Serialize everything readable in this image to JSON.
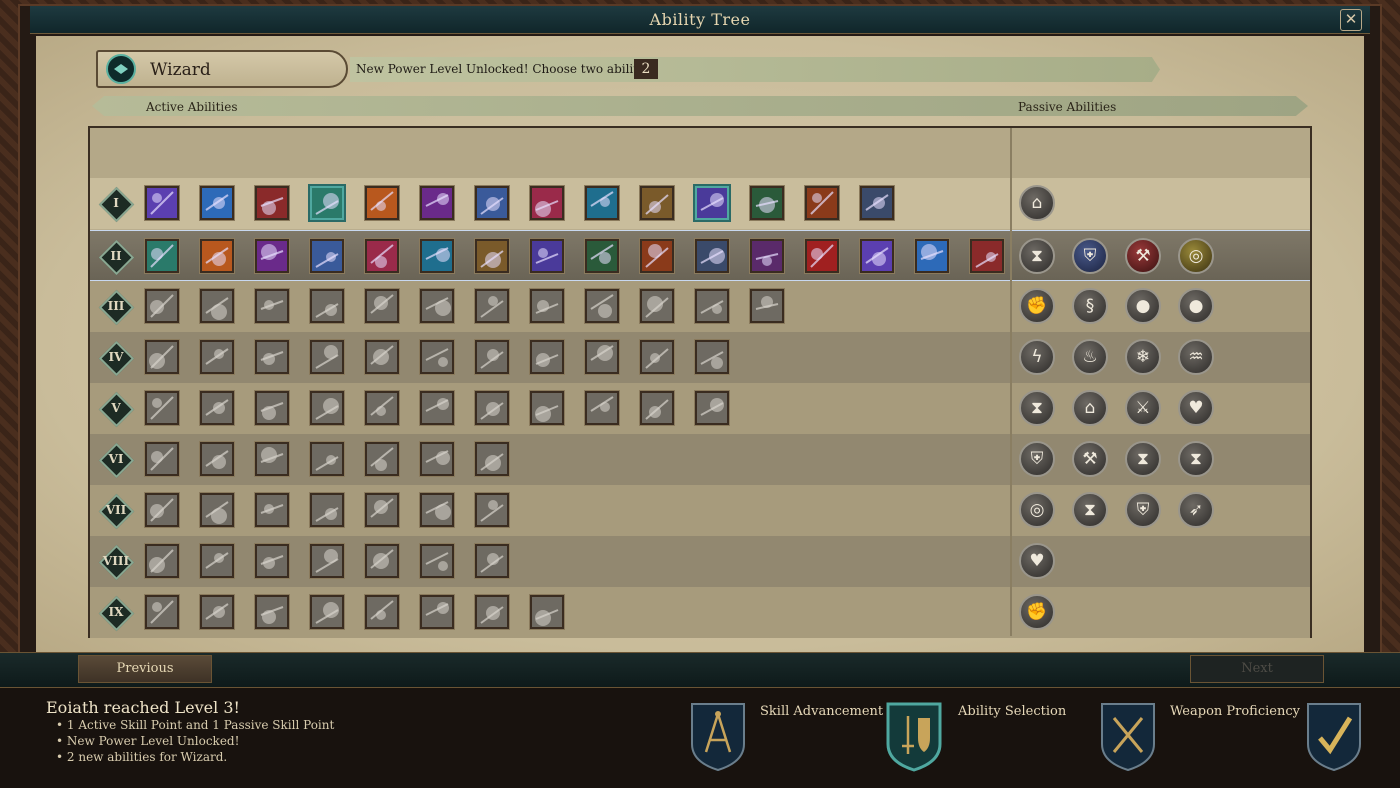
{
  "window": {
    "title": "Ability Tree"
  },
  "class_panel": {
    "name": "Wizard"
  },
  "banner": {
    "text": "New Power Level Unlocked! Choose two abilities.",
    "count": "2"
  },
  "sections": {
    "active": "Active Abilities",
    "passive": "Passive Abilities"
  },
  "levels": [
    "I",
    "II",
    "III",
    "IV",
    "V",
    "VI",
    "VII",
    "VIII",
    "IX"
  ],
  "selected_level": "II",
  "active_icon_counts": [
    14,
    16,
    12,
    11,
    11,
    7,
    7,
    7,
    8
  ],
  "passive_icons": [
    [
      "compass-icon"
    ],
    [
      "hourglass-icon",
      "shield-icon",
      "axe-icon",
      "target-icon"
    ],
    [
      "strength-icon",
      "serpent-icon",
      "mind-icon",
      "mind-icon"
    ],
    [
      "lightning-icon",
      "fire-icon",
      "frost-icon",
      "water-drop-icon"
    ],
    [
      "hourglass-icon",
      "compass-icon",
      "sword-icon",
      "heart-icon"
    ],
    [
      "shield-icon",
      "hammer-icon",
      "hourglass-icon",
      "hourglass-icon"
    ],
    [
      "target-icon",
      "hourglass-icon",
      "shield-icon",
      "bow-icon"
    ],
    [
      "heart-icon"
    ],
    [
      "strength-icon"
    ]
  ],
  "navigation": {
    "previous": "Previous",
    "next": "Next"
  },
  "level_up": {
    "title": "Eoiath reached Level 3!",
    "lines": [
      "• 1 Active Skill Point and 1 Passive Skill Point",
      "• New Power Level Unlocked!",
      "• 2 new abilities for Wizard."
    ]
  },
  "tabs": [
    {
      "label": "Skill Advancement",
      "icon": "compass-icon"
    },
    {
      "label": "Ability Selection",
      "icon": "sword-shield-icon"
    },
    {
      "label": "Weapon Proficiency",
      "icon": "crossed-weapons-icon"
    }
  ],
  "confirm": {
    "icon": "checkmark-icon"
  },
  "colors": {
    "accent_teal": "#4fa8a0",
    "parchment": "#c9bc9a",
    "frame": "#3a2418"
  }
}
